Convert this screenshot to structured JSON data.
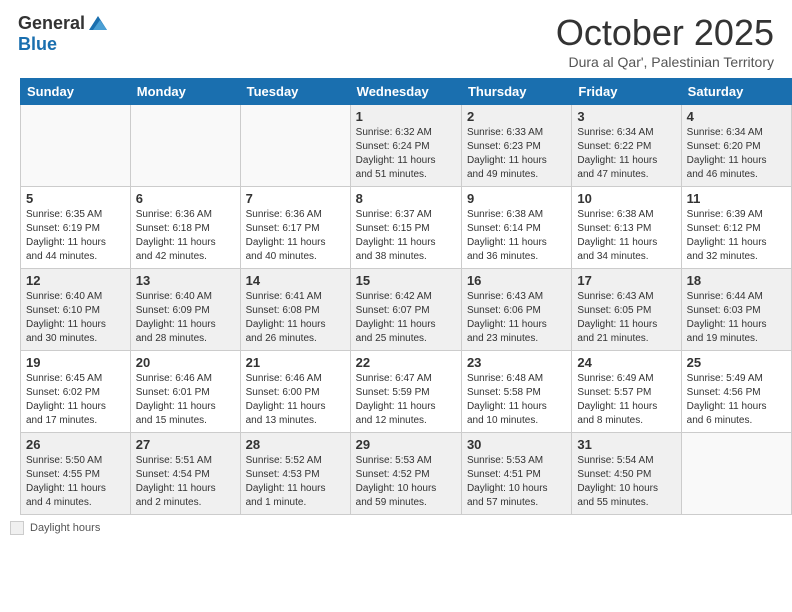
{
  "logo": {
    "general": "General",
    "blue": "Blue"
  },
  "title": "October 2025",
  "location": "Dura al Qar', Palestinian Territory",
  "days_of_week": [
    "Sunday",
    "Monday",
    "Tuesday",
    "Wednesday",
    "Thursday",
    "Friday",
    "Saturday"
  ],
  "legend_label": "Daylight hours",
  "weeks": [
    [
      {
        "day": "",
        "info": "",
        "empty": true
      },
      {
        "day": "",
        "info": "",
        "empty": true
      },
      {
        "day": "",
        "info": "",
        "empty": true
      },
      {
        "day": "1",
        "info": "Sunrise: 6:32 AM\nSunset: 6:24 PM\nDaylight: 11 hours\nand 51 minutes."
      },
      {
        "day": "2",
        "info": "Sunrise: 6:33 AM\nSunset: 6:23 PM\nDaylight: 11 hours\nand 49 minutes."
      },
      {
        "day": "3",
        "info": "Sunrise: 6:34 AM\nSunset: 6:22 PM\nDaylight: 11 hours\nand 47 minutes."
      },
      {
        "day": "4",
        "info": "Sunrise: 6:34 AM\nSunset: 6:20 PM\nDaylight: 11 hours\nand 46 minutes."
      }
    ],
    [
      {
        "day": "5",
        "info": "Sunrise: 6:35 AM\nSunset: 6:19 PM\nDaylight: 11 hours\nand 44 minutes."
      },
      {
        "day": "6",
        "info": "Sunrise: 6:36 AM\nSunset: 6:18 PM\nDaylight: 11 hours\nand 42 minutes."
      },
      {
        "day": "7",
        "info": "Sunrise: 6:36 AM\nSunset: 6:17 PM\nDaylight: 11 hours\nand 40 minutes."
      },
      {
        "day": "8",
        "info": "Sunrise: 6:37 AM\nSunset: 6:15 PM\nDaylight: 11 hours\nand 38 minutes."
      },
      {
        "day": "9",
        "info": "Sunrise: 6:38 AM\nSunset: 6:14 PM\nDaylight: 11 hours\nand 36 minutes."
      },
      {
        "day": "10",
        "info": "Sunrise: 6:38 AM\nSunset: 6:13 PM\nDaylight: 11 hours\nand 34 minutes."
      },
      {
        "day": "11",
        "info": "Sunrise: 6:39 AM\nSunset: 6:12 PM\nDaylight: 11 hours\nand 32 minutes."
      }
    ],
    [
      {
        "day": "12",
        "info": "Sunrise: 6:40 AM\nSunset: 6:10 PM\nDaylight: 11 hours\nand 30 minutes."
      },
      {
        "day": "13",
        "info": "Sunrise: 6:40 AM\nSunset: 6:09 PM\nDaylight: 11 hours\nand 28 minutes."
      },
      {
        "day": "14",
        "info": "Sunrise: 6:41 AM\nSunset: 6:08 PM\nDaylight: 11 hours\nand 26 minutes."
      },
      {
        "day": "15",
        "info": "Sunrise: 6:42 AM\nSunset: 6:07 PM\nDaylight: 11 hours\nand 25 minutes."
      },
      {
        "day": "16",
        "info": "Sunrise: 6:43 AM\nSunset: 6:06 PM\nDaylight: 11 hours\nand 23 minutes."
      },
      {
        "day": "17",
        "info": "Sunrise: 6:43 AM\nSunset: 6:05 PM\nDaylight: 11 hours\nand 21 minutes."
      },
      {
        "day": "18",
        "info": "Sunrise: 6:44 AM\nSunset: 6:03 PM\nDaylight: 11 hours\nand 19 minutes."
      }
    ],
    [
      {
        "day": "19",
        "info": "Sunrise: 6:45 AM\nSunset: 6:02 PM\nDaylight: 11 hours\nand 17 minutes."
      },
      {
        "day": "20",
        "info": "Sunrise: 6:46 AM\nSunset: 6:01 PM\nDaylight: 11 hours\nand 15 minutes."
      },
      {
        "day": "21",
        "info": "Sunrise: 6:46 AM\nSunset: 6:00 PM\nDaylight: 11 hours\nand 13 minutes."
      },
      {
        "day": "22",
        "info": "Sunrise: 6:47 AM\nSunset: 5:59 PM\nDaylight: 11 hours\nand 12 minutes."
      },
      {
        "day": "23",
        "info": "Sunrise: 6:48 AM\nSunset: 5:58 PM\nDaylight: 11 hours\nand 10 minutes."
      },
      {
        "day": "24",
        "info": "Sunrise: 6:49 AM\nSunset: 5:57 PM\nDaylight: 11 hours\nand 8 minutes."
      },
      {
        "day": "25",
        "info": "Sunrise: 5:49 AM\nSunset: 4:56 PM\nDaylight: 11 hours\nand 6 minutes."
      }
    ],
    [
      {
        "day": "26",
        "info": "Sunrise: 5:50 AM\nSunset: 4:55 PM\nDaylight: 11 hours\nand 4 minutes."
      },
      {
        "day": "27",
        "info": "Sunrise: 5:51 AM\nSunset: 4:54 PM\nDaylight: 11 hours\nand 2 minutes."
      },
      {
        "day": "28",
        "info": "Sunrise: 5:52 AM\nSunset: 4:53 PM\nDaylight: 11 hours\nand 1 minute."
      },
      {
        "day": "29",
        "info": "Sunrise: 5:53 AM\nSunset: 4:52 PM\nDaylight: 10 hours\nand 59 minutes."
      },
      {
        "day": "30",
        "info": "Sunrise: 5:53 AM\nSunset: 4:51 PM\nDaylight: 10 hours\nand 57 minutes."
      },
      {
        "day": "31",
        "info": "Sunrise: 5:54 AM\nSunset: 4:50 PM\nDaylight: 10 hours\nand 55 minutes."
      },
      {
        "day": "",
        "info": "",
        "empty": true
      }
    ]
  ]
}
